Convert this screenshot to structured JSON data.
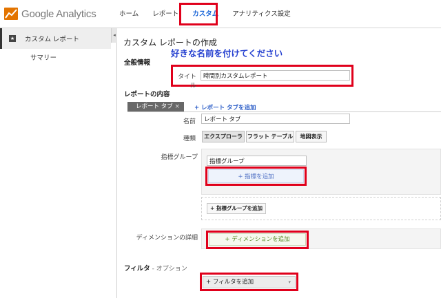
{
  "app": {
    "name": "Google Analytics"
  },
  "nav": {
    "items": [
      {
        "label": "ホーム"
      },
      {
        "label": "レポート"
      },
      {
        "label": "カスタム",
        "active": true
      },
      {
        "label": "アナリティクス設定"
      }
    ]
  },
  "sidebar": {
    "header": "カスタム レポート",
    "collapse_glyph": "◂",
    "items": [
      {
        "label": "サマリー"
      }
    ]
  },
  "page": {
    "title": "カスタム レポートの作成",
    "hint": "好きな名前を付けてください"
  },
  "general": {
    "heading": "全般情報",
    "title_label": "タイトル",
    "title_value": "時間別カスタムレポート"
  },
  "content": {
    "heading": "レポートの内容",
    "tab_chip": "レポート タブ",
    "tab_close": "×",
    "add_tab": "+ レポート タブを追加",
    "name_label": "名前",
    "name_value": "レポート タブ",
    "type_label": "種類",
    "types": [
      {
        "label": "エクスプローラ",
        "selected": true
      },
      {
        "label": "フラット テーブル",
        "selected": false
      },
      {
        "label": "地図表示",
        "selected": false
      }
    ],
    "metric_group_label": "指標グループ",
    "metric_group_value": "指標グループ",
    "add_metric": "+ 指標を追加",
    "add_metric_group": "+ 指標グループを追加",
    "dimension_label": "ディメンションの詳細",
    "add_dimension": "+ ディメンションを追加"
  },
  "filter": {
    "heading": "フィルタ",
    "optional": " - オプション",
    "add_filter": "+ フィルタを追加",
    "arrow": "▾"
  },
  "colors": {
    "highlight": "#e0001b",
    "accent": "#1a66d8",
    "hint": "#2540d0"
  }
}
